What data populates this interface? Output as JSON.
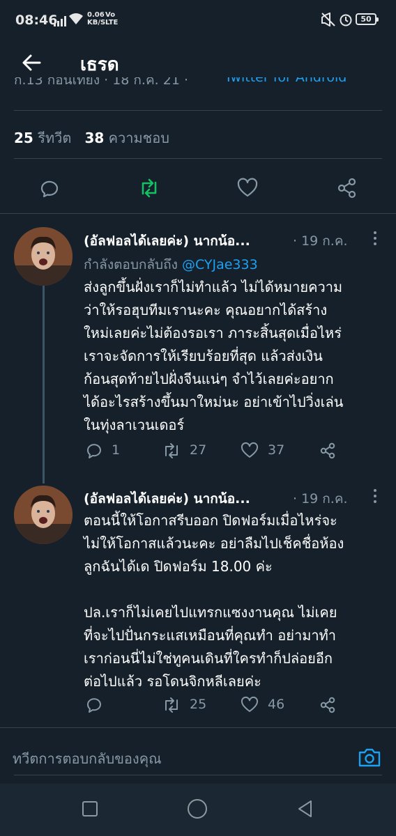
{
  "status_bar": {
    "time": "08:46",
    "net_speed_top": "0.06",
    "net_speed_bottom": "KB/S",
    "net_type_top": "Vo",
    "net_type_bottom": "LTE",
    "battery": "50",
    "icons": [
      "signal-icon",
      "wifi-icon",
      "mute-icon",
      "alarm-icon",
      "lock-icon"
    ]
  },
  "header": {
    "title": "เธรด",
    "back_icon": "arrow-left-icon"
  },
  "meta_partial": {
    "left": "ก.13 ก่อนเที่ยง · 18 ก.ค. 21 ·",
    "source": "Twitter for Android"
  },
  "stats": {
    "retweets_count": "25",
    "retweets_label": "รีทวีต",
    "likes_count": "38",
    "likes_label": "ความชอบ"
  },
  "main_actions": [
    "reply-icon",
    "retweet-icon",
    "like-icon",
    "share-icon"
  ],
  "colors": {
    "background": "#15202b",
    "divider": "#38444d",
    "secondary_text": "#8899a6",
    "link": "#1da1f2",
    "retweeted_green": "#17bf63"
  },
  "replies": [
    {
      "name": "(อัลฟอลได้เลยค่ะ) นากน้อ...",
      "date": "· 19 ก.ค.",
      "reply_to_label": "กำลังตอบกลับถึง",
      "reply_to_handle": "@CYJae333",
      "text": "ส่งลูกขึ้นฝั่งเราก็ไม่ทำแล้ว ไม่ได้หมายความ\nว่าให้รอฮุบทีมเรานะคะ คุณอยากได้สร้าง\nใหม่เลยค่ะไม่ต้องรอเรา ภาระสิ้นสุดเมื่อไหร่\nเราจะจัดการให้เรียบร้อยที่สุด แล้วส่งเงิน\nก้อนสุดท้ายไปฝั่งจีนแน่ๆ จำไว้เลยค่ะอยาก\nได้อะไรสร้างขึ้นมาใหม่นะ อย่าเข้าไปวิ่งเล่น\nในทุ่งลาเวนเดอร์",
      "replies": "1",
      "retweets": "27",
      "likes": "37"
    },
    {
      "name": "(อัลฟอลได้เลยค่ะ) นากน้อ...",
      "date": "· 19 ก.ค.",
      "text": "ตอนนี้ให้โอกาสรีบออก ปิดฟอร์มเมื่อไหร่จะ\nไม่ให้โอกาสแล้วนะคะ อย่าลืมไปเช็คชื่อห้อง\nลูกฉันได้เด ปิดฟอร์ม 18.00 ค่ะ\n\nปล.เราก็ไม่เคยไปแทรกแซงงานคุณ ไม่เคย\nที่จะไปปั่นกระแสเหมือนที่คุณทำ อย่ามาทำ\nเราก่อนนี่ไม่ใช่ทูคนเดินที่ใครทำก็ปล่อยอีก\nต่อไปแล้ว รอโดนจิกหลีเลยค่ะ",
      "replies": "",
      "retweets": "25",
      "likes": "46"
    }
  ],
  "compose": {
    "placeholder": "ทวีตการตอบกลับของคุณ",
    "camera_icon": "camera-icon"
  },
  "nav_bar": [
    "recents-button",
    "home-button",
    "back-button"
  ]
}
